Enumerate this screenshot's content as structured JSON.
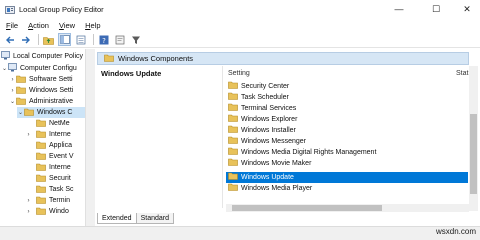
{
  "window": {
    "title": "Local Group Policy Editor",
    "controls": {
      "minimize": "—",
      "maximize": "☐",
      "close": "✕"
    }
  },
  "menu": [
    {
      "label": "File",
      "accel": "F",
      "rest": "ile"
    },
    {
      "label": "Action",
      "accel": "A",
      "rest": "ction"
    },
    {
      "label": "View",
      "accel": "V",
      "rest": "iew"
    },
    {
      "label": "Help",
      "accel": "H",
      "rest": "elp"
    }
  ],
  "toolbar": {
    "icons": [
      "back-arrow-icon",
      "forward-arrow-icon",
      "folder-up-icon",
      "show-hide-tree-icon",
      "help-icon",
      "properties-icon",
      "filter-icon"
    ]
  },
  "tree": {
    "items": [
      {
        "label": "Local Computer Policy",
        "arrow": "",
        "level": 0,
        "icon": "computer-policy-icon"
      },
      {
        "label": "Computer Configuration",
        "arrow": "⌄",
        "level": 1,
        "icon": "computer-config-icon"
      },
      {
        "label": "Software Settings",
        "arrow": "›",
        "level": 2,
        "icon": "folder-icon"
      },
      {
        "label": "Windows Settings",
        "arrow": "›",
        "level": 2,
        "icon": "folder-icon"
      },
      {
        "label": "Administrative Templates",
        "arrow": "⌄",
        "level": 2,
        "icon": "folder-icon"
      },
      {
        "label": "Windows Components",
        "arrow": "⌄",
        "level": 3,
        "icon": "folder-icon",
        "selected": true
      },
      {
        "label": "NetMeeting",
        "arrow": "",
        "level": 4,
        "icon": "folder-icon"
      },
      {
        "label": "Internet Explorer",
        "arrow": "›",
        "level": 4,
        "icon": "folder-icon"
      },
      {
        "label": "Application Compatibility",
        "arrow": "",
        "level": 4,
        "icon": "folder-icon"
      },
      {
        "label": "Event Viewer",
        "arrow": "",
        "level": 4,
        "icon": "folder-icon"
      },
      {
        "label": "Internet Information Services",
        "arrow": "",
        "level": 4,
        "icon": "folder-icon"
      },
      {
        "label": "Security Center",
        "arrow": "",
        "level": 4,
        "icon": "folder-icon"
      },
      {
        "label": "Task Scheduler",
        "arrow": "",
        "level": 4,
        "icon": "folder-icon"
      },
      {
        "label": "Terminal Services",
        "arrow": "›",
        "level": 4,
        "icon": "folder-icon"
      },
      {
        "label": "Windows Explorer",
        "arrow": "›",
        "level": 4,
        "icon": "folder-icon"
      }
    ]
  },
  "tree_visible_labels": [
    "Local Computer Policy",
    "Computer Configu",
    "Software Setti",
    "Windows Setti",
    "Administrative",
    "Windows C",
    "NetMe",
    "Interne",
    "Applica",
    "Event V",
    "Interne",
    "Securit",
    "Task Sc",
    "Termin",
    "Windo"
  ],
  "header": {
    "label": "Windows Components"
  },
  "details": {
    "title": "Windows Update",
    "columns": {
      "setting": "Setting",
      "state": "Stat"
    },
    "rows": [
      {
        "label": "Security Center"
      },
      {
        "label": "Task Scheduler"
      },
      {
        "label": "Terminal Services"
      },
      {
        "label": "Windows Explorer"
      },
      {
        "label": "Windows Installer"
      },
      {
        "label": "Windows Messenger"
      },
      {
        "label": "Windows Media Digital Rights Management"
      },
      {
        "label": "Windows Movie Maker"
      },
      {
        "label": "Windows Update",
        "selected": true
      },
      {
        "label": "Windows Media Player"
      }
    ]
  },
  "tabs": [
    {
      "label": "Extended",
      "active": true
    },
    {
      "label": "Standard",
      "active": false
    }
  ],
  "watermark": "wsxdn.com",
  "colors": {
    "selection": "#0078d7",
    "header_strip": "#d6e6f5",
    "tree_selection": "#cce4f7",
    "folder": "#e8c25a"
  }
}
